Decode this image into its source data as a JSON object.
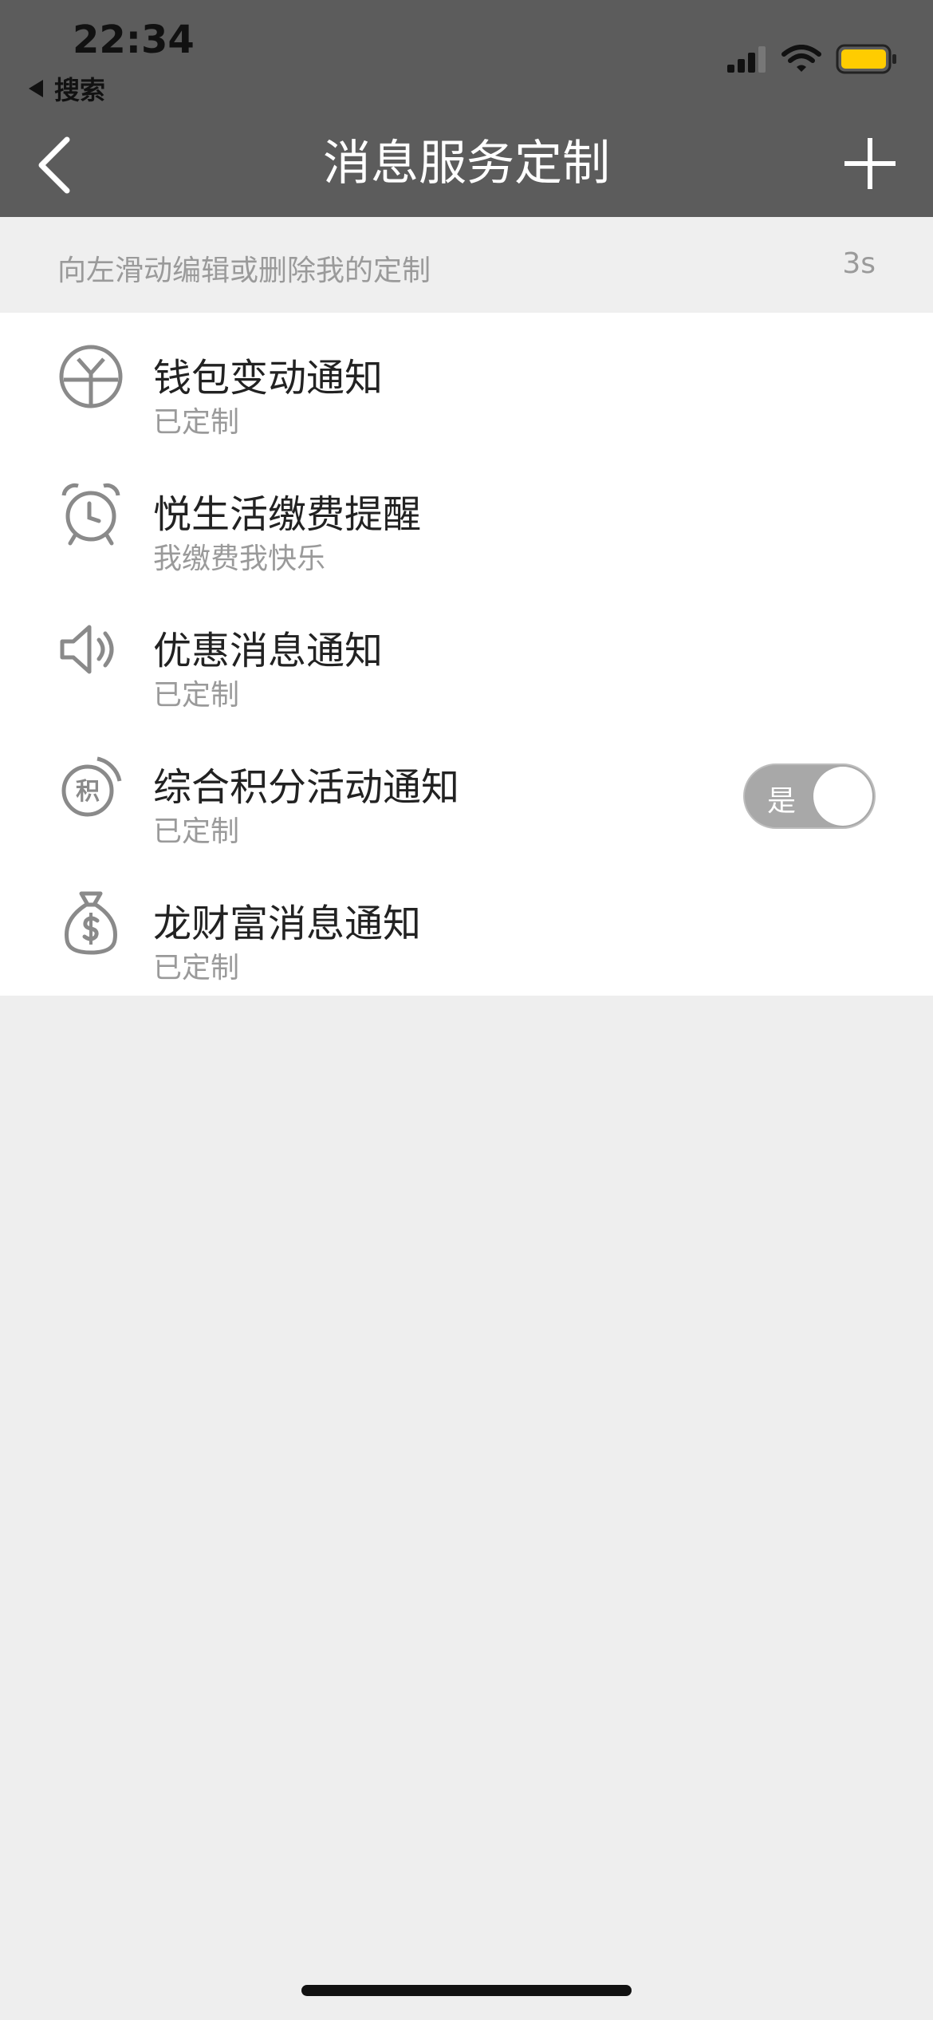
{
  "status_bar": {
    "time": "22:34",
    "back_app": "搜索"
  },
  "nav": {
    "title": "消息服务定制"
  },
  "hint": {
    "text": "向左滑动编辑或删除我的定制",
    "countdown": "3s"
  },
  "items": [
    {
      "title": "钱包变动通知",
      "subtitle": "已定制",
      "icon": "yuan-coin-icon"
    },
    {
      "title": "悦生活缴费提醒",
      "subtitle": "我缴费我快乐",
      "icon": "alarm-clock-icon"
    },
    {
      "title": "优惠消息通知",
      "subtitle": "已定制",
      "icon": "speaker-icon"
    },
    {
      "title": "综合积分活动通知",
      "subtitle": "已定制",
      "icon": "points-icon",
      "points_glyph": "积",
      "toggle_label": "是",
      "toggle_on": true
    },
    {
      "title": "龙财富消息通知",
      "subtitle": "已定制",
      "icon": "money-bag-icon"
    }
  ],
  "colors": {
    "header": "#5c5c5c",
    "battery": "#ffcc00",
    "toggle": "#a8a8a8"
  }
}
